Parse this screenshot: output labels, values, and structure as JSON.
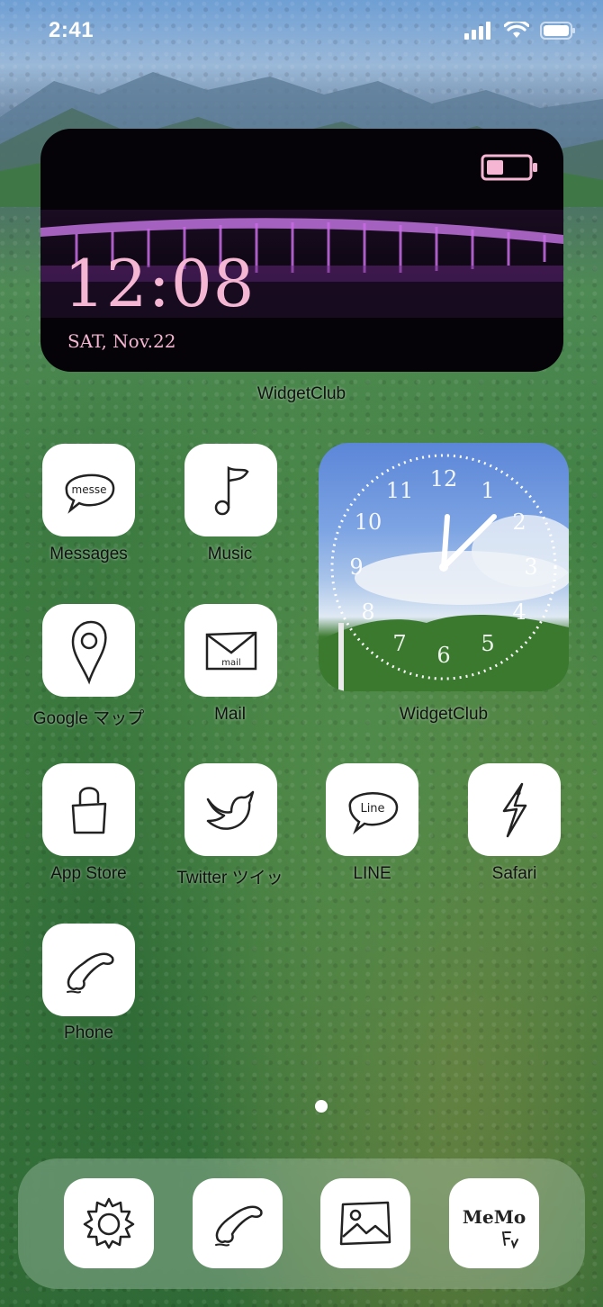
{
  "status_bar": {
    "time": "2:41"
  },
  "photo_widget": {
    "time": "12:08",
    "date": "SAT, Nov.22",
    "label": "WidgetClub"
  },
  "clock_widget": {
    "label": "WidgetClub",
    "numbers": [
      "12",
      "1",
      "2",
      "3",
      "4",
      "5",
      "6",
      "7",
      "8",
      "9",
      "10",
      "11"
    ]
  },
  "apps": [
    {
      "name": "Messages",
      "icon": "messages-icon",
      "icon_text": "messe"
    },
    {
      "name": "Music",
      "icon": "music-icon"
    },
    {
      "name": "Google マップ",
      "icon": "maps-icon"
    },
    {
      "name": "Mail",
      "icon": "mail-icon",
      "icon_text": "mail"
    },
    {
      "name": "App Store",
      "icon": "app-store-icon"
    },
    {
      "name": "Twitter ツイッ",
      "icon": "twitter-icon"
    },
    {
      "name": "LINE",
      "icon": "line-icon",
      "icon_text": "Line"
    },
    {
      "name": "Safari",
      "icon": "safari-icon"
    },
    {
      "name": "Phone",
      "icon": "phone-icon"
    }
  ],
  "dock": [
    {
      "icon": "settings-icon"
    },
    {
      "icon": "phone-icon"
    },
    {
      "icon": "photos-icon"
    },
    {
      "icon": "memo-icon",
      "icon_text": "MeMo"
    }
  ],
  "colors": {
    "accent_pink": "#f4b6d2",
    "icon_bg": "#ffffff",
    "label_text": "#111111"
  }
}
